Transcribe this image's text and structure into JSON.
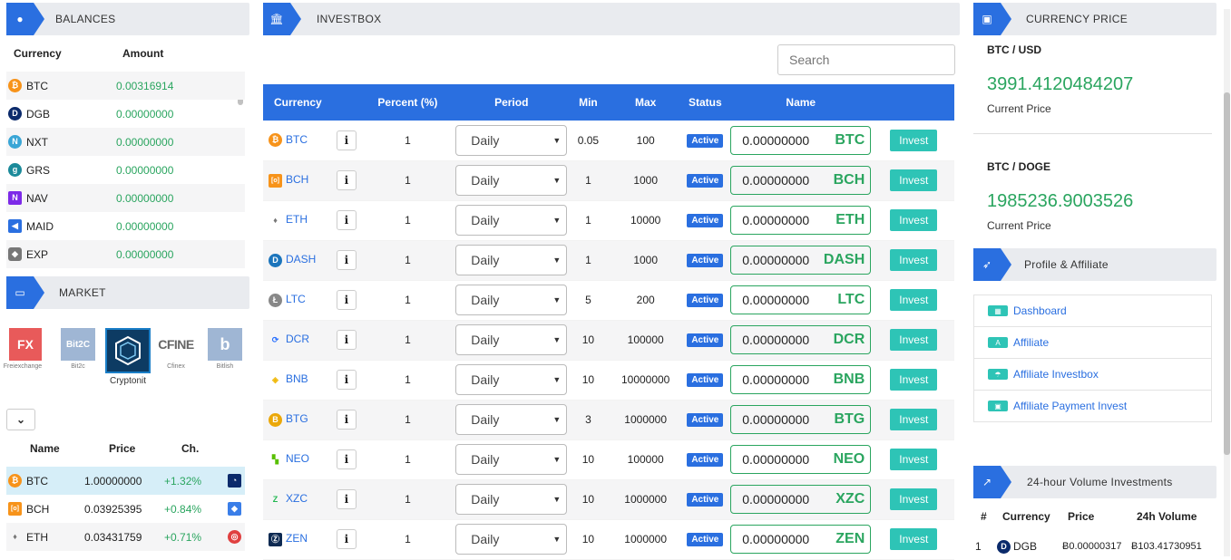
{
  "balances": {
    "title": "BALANCES",
    "col_currency": "Currency",
    "col_amount": "Amount",
    "rows": [
      {
        "symbol": "BTC",
        "amount": "0.00316914"
      },
      {
        "symbol": "DGB",
        "amount": "0.00000000"
      },
      {
        "symbol": "NXT",
        "amount": "0.00000000"
      },
      {
        "symbol": "GRS",
        "amount": "0.00000000"
      },
      {
        "symbol": "NAV",
        "amount": "0.00000000"
      },
      {
        "symbol": "MAID",
        "amount": "0.00000000"
      },
      {
        "symbol": "EXP",
        "amount": "0.00000000"
      }
    ]
  },
  "market": {
    "title": "MARKET",
    "exchanges": [
      {
        "name": "Freiexchange",
        "logo_text": "FX"
      },
      {
        "name": "Bit2c",
        "logo_text": "Bit2C"
      },
      {
        "name": "Cryptonit",
        "logo_text": ""
      },
      {
        "name": "Cfinex",
        "logo_text": "CFINE"
      },
      {
        "name": "Bitlish",
        "logo_text": "b"
      }
    ],
    "col_name": "Name",
    "col_price": "Price",
    "col_change": "Ch.",
    "rows": [
      {
        "symbol": "BTC",
        "price": "1.00000000",
        "change": "+1.32%"
      },
      {
        "symbol": "BCH",
        "price": "0.03925395",
        "change": "+0.84%"
      },
      {
        "symbol": "ETH",
        "price": "0.03431759",
        "change": "+0.71%"
      }
    ]
  },
  "investbox": {
    "title": "INVESTBOX",
    "search_placeholder": "Search",
    "headers": [
      "Currency",
      "Percent (%)",
      "Period",
      "Min",
      "Max",
      "Status",
      "Name"
    ],
    "info_label": "i",
    "status_label": "Active",
    "invest_label": "Invest",
    "rows": [
      {
        "symbol": "BTC",
        "percent": "1",
        "period": "Daily",
        "min": "0.05",
        "max": "100",
        "amount": "0.00000000"
      },
      {
        "symbol": "BCH",
        "percent": "1",
        "period": "Daily",
        "min": "1",
        "max": "1000",
        "amount": "0.00000000"
      },
      {
        "symbol": "ETH",
        "percent": "1",
        "period": "Daily",
        "min": "1",
        "max": "10000",
        "amount": "0.00000000"
      },
      {
        "symbol": "DASH",
        "percent": "1",
        "period": "Daily",
        "min": "1",
        "max": "1000",
        "amount": "0.00000000"
      },
      {
        "symbol": "LTC",
        "percent": "1",
        "period": "Daily",
        "min": "5",
        "max": "200",
        "amount": "0.00000000"
      },
      {
        "symbol": "DCR",
        "percent": "1",
        "period": "Daily",
        "min": "10",
        "max": "100000",
        "amount": "0.00000000"
      },
      {
        "symbol": "BNB",
        "percent": "1",
        "period": "Daily",
        "min": "10",
        "max": "10000000",
        "amount": "0.00000000"
      },
      {
        "symbol": "BTG",
        "percent": "1",
        "period": "Daily",
        "min": "3",
        "max": "1000000",
        "amount": "0.00000000"
      },
      {
        "symbol": "NEO",
        "percent": "1",
        "period": "Daily",
        "min": "10",
        "max": "100000",
        "amount": "0.00000000"
      },
      {
        "symbol": "XZC",
        "percent": "1",
        "period": "Daily",
        "min": "10",
        "max": "1000000",
        "amount": "0.00000000"
      },
      {
        "symbol": "ZEN",
        "percent": "1",
        "period": "Daily",
        "min": "10",
        "max": "1000000",
        "amount": "0.00000000"
      }
    ]
  },
  "currency_price": {
    "title": "CURRENCY PRICE",
    "pairs": [
      {
        "pair": "BTC / USD",
        "price": "3991.4120484207",
        "label": "Current Price"
      },
      {
        "pair": "BTC / DOGE",
        "price": "1985236.9003526",
        "label": "Current Price"
      }
    ]
  },
  "profile": {
    "title": "Profile & Affiliate",
    "links": [
      "Dashboard",
      "Affiliate",
      "Affiliate Investbox",
      "Affiliate Payment Invest"
    ]
  },
  "volume": {
    "title": "24-hour Volume Investments",
    "headers": [
      "#",
      "Currency",
      "Price",
      "24h Volume"
    ],
    "rows": [
      {
        "rank": "1",
        "symbol": "DGB",
        "price": "Ƀ0.00000317",
        "volume": "Ƀ103.41730951"
      }
    ]
  },
  "colors": {
    "accent": "#2a6fe0",
    "green": "#2aa55f",
    "teal": "#2ec4b6"
  }
}
